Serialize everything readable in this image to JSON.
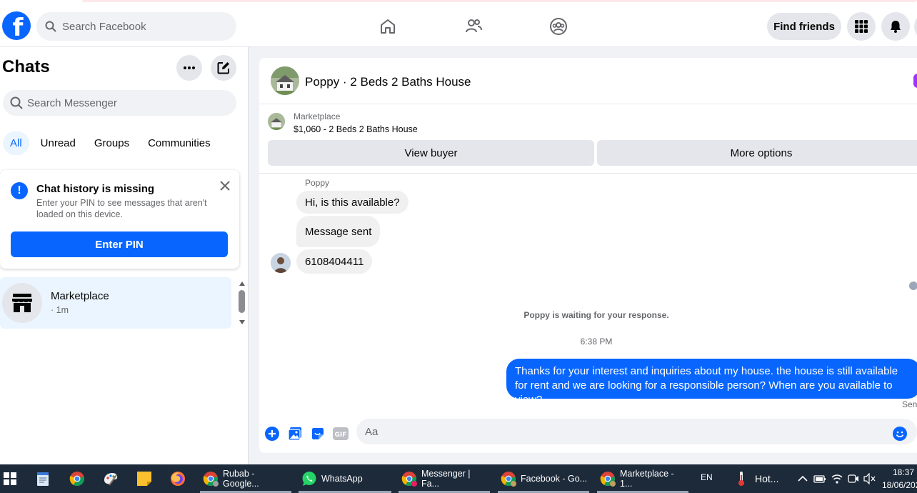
{
  "header": {
    "logo_letter": "f",
    "search_placeholder": "Search Facebook",
    "find_friends_label": "Find friends"
  },
  "left_panel": {
    "title": "Chats",
    "search_placeholder": "Search Messenger",
    "filters": [
      "All",
      "Unread",
      "Groups",
      "Communities"
    ],
    "notice": {
      "title": "Chat history is missing",
      "description": "Enter your PIN to see messages that aren't loaded on this device.",
      "button_label": "Enter PIN"
    },
    "chats": [
      {
        "name": "Marketplace",
        "time": "· 1m"
      }
    ]
  },
  "conversation": {
    "title": "Poppy · 2 Beds 2 Baths House",
    "marketplace_label": "Marketplace",
    "listing": "$1,060 - 2 Beds 2 Baths House",
    "view_buyer_label": "View buyer",
    "more_options_label": "More options",
    "sender_name": "Poppy",
    "incoming_messages": [
      "Hi, is this available?",
      "Message sent",
      "6108404411"
    ],
    "waiting_note": "Poppy is waiting for your response.",
    "timestamp": "6:38 PM",
    "outgoing_message": "Thanks for your interest and inquiries about my house. the house is still available for rent and we are looking for a responsible person? When are you available to view?",
    "sent_label": "Sent",
    "composer_placeholder": "Aa"
  },
  "taskbar": {
    "apps": [
      {
        "label": "Rubab - Google..."
      },
      {
        "label": "WhatsApp"
      },
      {
        "label": "Messenger | Fa..."
      },
      {
        "label": "Facebook - Go..."
      },
      {
        "label": "Marketplace - 1..."
      }
    ],
    "language": "EN",
    "weather": "Hot...",
    "time": "18:37",
    "date": "18/06/202"
  },
  "colors": {
    "brand_blue": "#0866ff",
    "bubble_grey": "#f0f0f0",
    "taskbar_bg": "#1c2a3a"
  }
}
